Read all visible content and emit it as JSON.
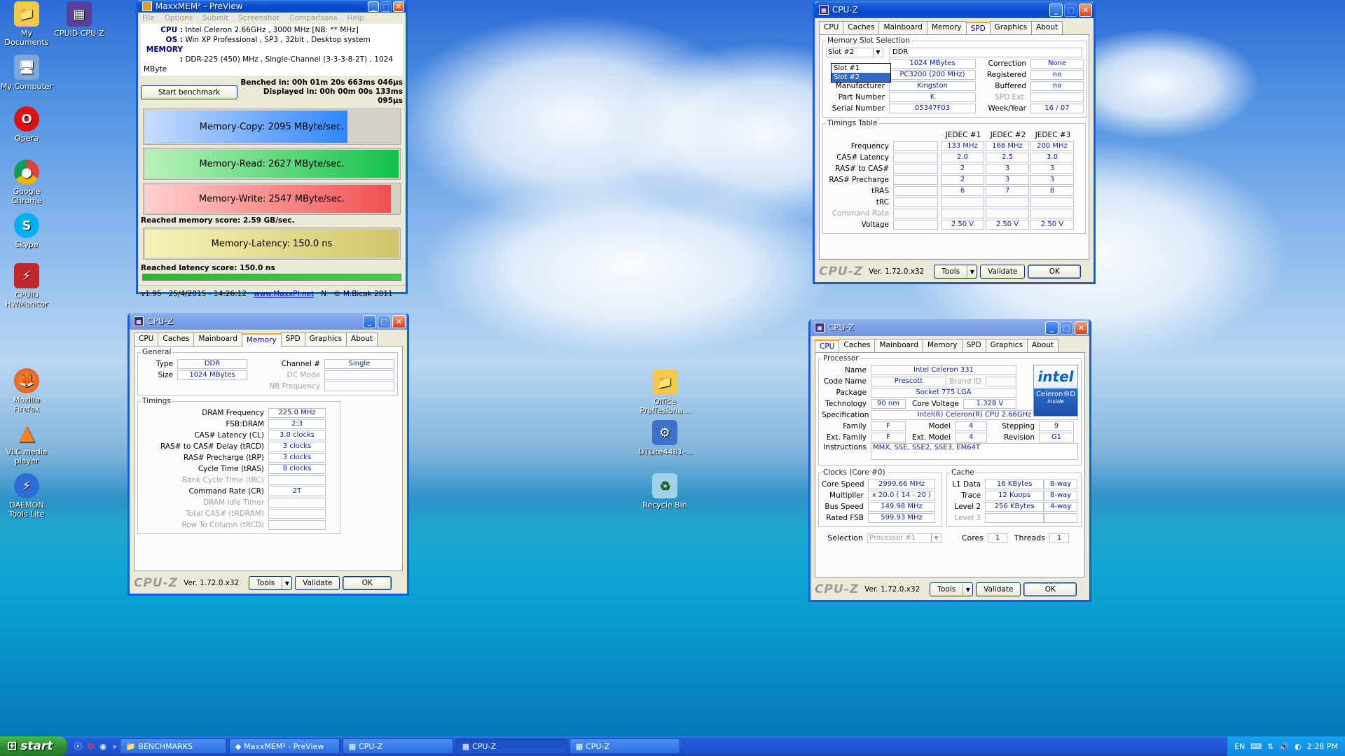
{
  "desktop": {
    "icons": [
      {
        "label": "My Documents"
      },
      {
        "label": "CPUID CPU-Z"
      },
      {
        "label": "My Computer"
      },
      {
        "label": "Opera"
      },
      {
        "label": "Google Chrome"
      },
      {
        "label": "Skype"
      },
      {
        "label": "CPUID HWMonitor"
      },
      {
        "label": "Mozilla Firefox"
      },
      {
        "label": "VLC media player"
      },
      {
        "label": "DAEMON Tools Lite"
      },
      {
        "label": "Office Proffesiona..."
      },
      {
        "label": "DTLite4481-..."
      },
      {
        "label": "Recycle Bin"
      }
    ]
  },
  "maxxmem": {
    "title": "MaxxMEM² - PreView",
    "menu": [
      "File",
      "Options",
      "Submit",
      "Screenshot",
      "Comparisons",
      "Help"
    ],
    "cpu_label": "CPU :",
    "cpu_value": "Intel Celeron 2.66GHz , 3000 MHz  [NB: ** MHz]",
    "os_label": "OS :",
    "os_value": "Win XP Professional , SP3 , 32bit , Desktop system",
    "mem_label": "MEMORY :",
    "mem_value": "DDR-225 (450) MHz , Single-Channel (3-3-3-8-2T) , 1024 MByte",
    "start_button": "Start benchmark",
    "benched": "Benched in: 00h 01m 20s 663ms 046µs",
    "displayed": "Displayed in: 00h 00m 00s 133ms 095µs",
    "copy": {
      "label": "Memory-Copy: 2095 MByte/sec.",
      "level": 0.8
    },
    "read": {
      "label": "Memory-Read: 2627 MByte/sec.",
      "level": 1.0
    },
    "write": {
      "label": "Memory-Write: 2547 MByte/sec.",
      "level": 0.97
    },
    "score": "Reached memory score: 2.59 GB/sec.",
    "latency": {
      "label": "Memory-Latency: 150.0 ns",
      "level": 1.0
    },
    "latency_score": "Reached latency score: 150.0 ns",
    "footer_version": "v1.95",
    "footer_date": "25/4/2015 - 14:26:12",
    "footer_link": "www.MaxxPI.net",
    "footer_n": "N",
    "footer_copyright": "© M.Bicak 2011"
  },
  "cpuz_common": {
    "title": "CPU-Z",
    "tabs": [
      "CPU",
      "Caches",
      "Mainboard",
      "Memory",
      "SPD",
      "Graphics",
      "About"
    ],
    "logo": "CPU-Z",
    "version": "Ver. 1.72.0.x32",
    "tools": "Tools",
    "validate": "Validate",
    "ok": "OK"
  },
  "cpuz_spd": {
    "section": "Memory Slot Selection",
    "slot_selected": "Slot #2",
    "slot_options": [
      "Slot #1",
      "Slot #2"
    ],
    "type": "DDR",
    "module_size": "1024 MBytes",
    "max_bandwidth": "PC3200 (200 MHz)",
    "manufacturer_label": "Manufacturer",
    "manufacturer": "Kingston",
    "part_label": "Part Number",
    "part": "K",
    "serial_label": "Serial Number",
    "serial": "05347F03",
    "correction_label": "Correction",
    "correction": "None",
    "registered_label": "Registered",
    "registered": "no",
    "buffered_label": "Buffered",
    "buffered": "no",
    "spdext_label": "SPD Ext.",
    "weekyear_label": "Week/Year",
    "weekyear": "16 / 07",
    "timings_section": "Timings Table",
    "jedec_headers": [
      "JEDEC #1",
      "JEDEC #2",
      "JEDEC #3"
    ],
    "rows": [
      {
        "label": "Frequency",
        "values": [
          "133 MHz",
          "166 MHz",
          "200 MHz"
        ]
      },
      {
        "label": "CAS# Latency",
        "values": [
          "2.0",
          "2.5",
          "3.0"
        ]
      },
      {
        "label": "RAS# to CAS#",
        "values": [
          "2",
          "3",
          "3"
        ]
      },
      {
        "label": "RAS# Precharge",
        "values": [
          "2",
          "3",
          "3"
        ]
      },
      {
        "label": "tRAS",
        "values": [
          "6",
          "7",
          "8"
        ]
      },
      {
        "label": "tRC",
        "values": [
          "",
          "",
          ""
        ]
      },
      {
        "label": "Command Rate",
        "values": [
          "",
          "",
          ""
        ]
      },
      {
        "label": "Voltage",
        "values": [
          "2.50 V",
          "2.50 V",
          "2.50 V"
        ]
      }
    ]
  },
  "cpuz_mem": {
    "general": "General",
    "type_label": "Type",
    "type": "DDR",
    "size_label": "Size",
    "size": "1024 MBytes",
    "channel_label": "Channel #",
    "channel": "Single",
    "dcmode_label": "DC Mode",
    "nbfreq_label": "NB Frequency",
    "timings": "Timings",
    "rows": [
      {
        "label": "DRAM Frequency",
        "value": "225.0 MHz",
        "dim": false
      },
      {
        "label": "FSB:DRAM",
        "value": "2:3",
        "dim": false
      },
      {
        "label": "CAS# Latency (CL)",
        "value": "3.0 clocks",
        "dim": false
      },
      {
        "label": "RAS# to CAS# Delay (tRCD)",
        "value": "3 clocks",
        "dim": false
      },
      {
        "label": "RAS# Precharge (tRP)",
        "value": "3 clocks",
        "dim": false
      },
      {
        "label": "Cycle Time (tRAS)",
        "value": "8 clocks",
        "dim": false
      },
      {
        "label": "Bank Cycle Time (tRC)",
        "value": "",
        "dim": true
      },
      {
        "label": "Command Rate (CR)",
        "value": "2T",
        "dim": false
      },
      {
        "label": "DRAM Idle Timer",
        "value": "",
        "dim": true
      },
      {
        "label": "Total CAS# (tRDRAM)",
        "value": "",
        "dim": true
      },
      {
        "label": "Row To Column (tRCD)",
        "value": "",
        "dim": true
      }
    ]
  },
  "cpuz_cpu": {
    "processor": "Processor",
    "name_label": "Name",
    "name": "Intel Celeron 331",
    "codename_label": "Code Name",
    "codename": "Prescott",
    "brandid_label": "Brand ID",
    "package_label": "Package",
    "package": "Socket 775 LGA",
    "tech_label": "Technology",
    "tech": "90 nm",
    "corev_label": "Core Voltage",
    "corev": "1.328 V",
    "spec_label": "Specification",
    "spec": "Intel(R) Celeron(R) CPU 2.66GHz",
    "family_label": "Family",
    "family": "F",
    "model_label": "Model",
    "model": "4",
    "stepping_label": "Stepping",
    "stepping": "9",
    "extfamily_label": "Ext. Family",
    "extfamily": "F",
    "extmodel_label": "Ext. Model",
    "extmodel": "4",
    "revision_label": "Revision",
    "revision": "G1",
    "instr_label": "Instructions",
    "instr": "MMX, SSE, SSE2, SSE3, EM64T",
    "clocks": "Clocks (Core #0)",
    "corespeed_label": "Core Speed",
    "corespeed": "2999.66 MHz",
    "mult_label": "Multiplier",
    "mult": "x 20.0 ( 14 - 20 )",
    "bus_label": "Bus Speed",
    "bus": "149.98 MHz",
    "fsb_label": "Rated FSB",
    "fsb": "599.93 MHz",
    "cache": "Cache",
    "l1_label": "L1 Data",
    "l1": "16 KBytes",
    "l1way": "8-way",
    "trace_label": "Trace",
    "trace": "12 Kuops",
    "traceway": "8-way",
    "l2_label": "Level 2",
    "l2": "256 KBytes",
    "l2way": "4-way",
    "l3_label": "Level 3",
    "selection_label": "Selection",
    "selection": "Processor #1",
    "cores_label": "Cores",
    "cores": "1",
    "threads_label": "Threads",
    "threads": "1",
    "intel_logo": "intel",
    "intel_sub": "Celeron®D",
    "intel_inside": "inside"
  },
  "taskbar": {
    "start": "start",
    "items": [
      "BENCHMARKS",
      "MaxxMEM² - PreView",
      "CPU-Z",
      "CPU-Z",
      "CPU-Z"
    ],
    "lang": "EN",
    "clock": "2:28 PM"
  }
}
